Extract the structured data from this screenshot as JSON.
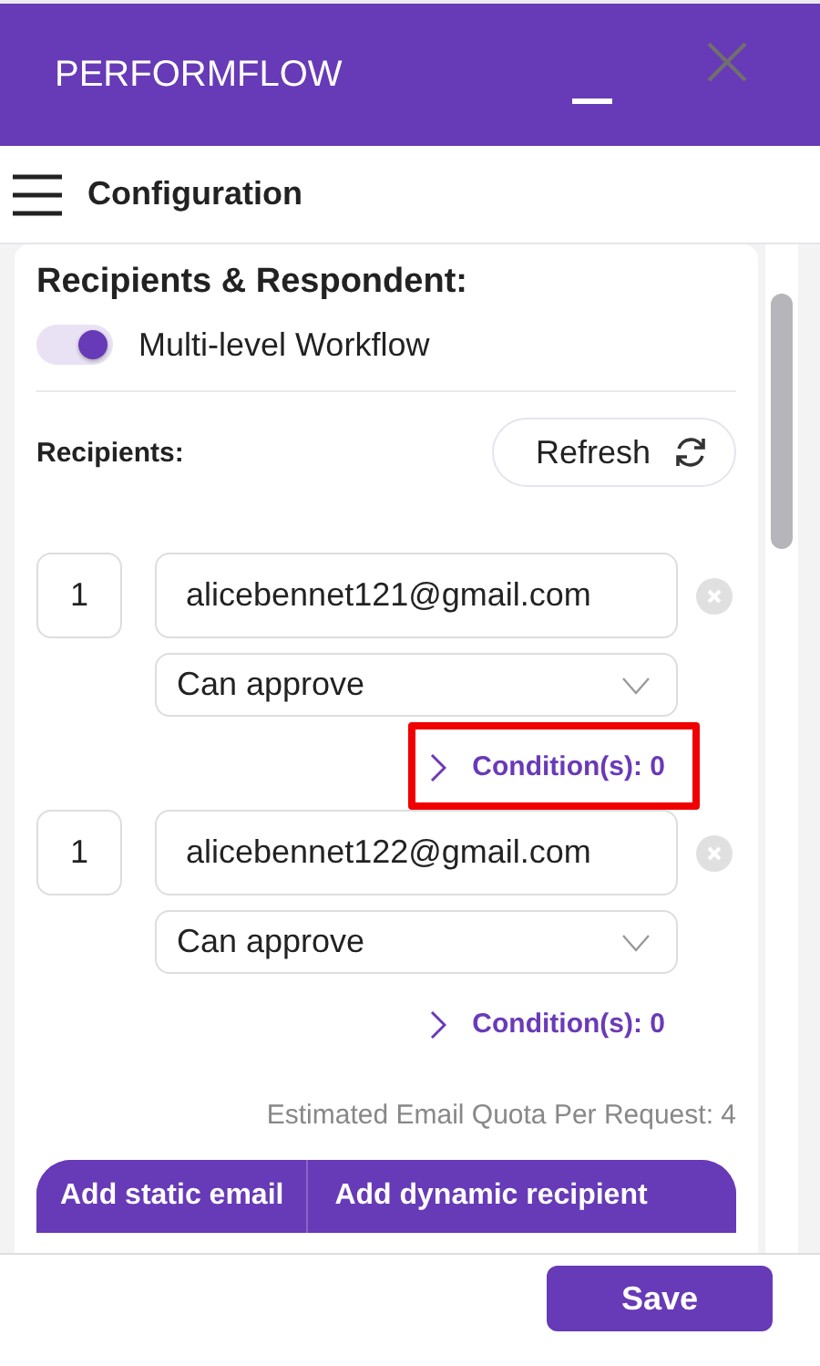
{
  "app": {
    "title": "PERFORMFLOW"
  },
  "toolbar": {
    "title": "Configuration"
  },
  "section": {
    "title": "Recipients & Respondent:",
    "toggle": {
      "label": "Multi-level Workflow",
      "on": true
    }
  },
  "recipients_header": {
    "label": "Recipients:",
    "refresh_button": "Refresh"
  },
  "recipients": [
    {
      "order": "1",
      "email": "alicebennet121@gmail.com",
      "permission": "Can approve",
      "conditions": "Condition(s): 0",
      "highlighted": true
    },
    {
      "order": "1",
      "email": "alicebennet122@gmail.com",
      "permission": "Can approve",
      "conditions": "Condition(s): 0",
      "highlighted": false
    }
  ],
  "quota": "Estimated Email Quota Per Request: 4",
  "add_buttons": [
    "Add static email",
    "Add dynamic recipient"
  ],
  "footer": {
    "save_button": "Save"
  }
}
